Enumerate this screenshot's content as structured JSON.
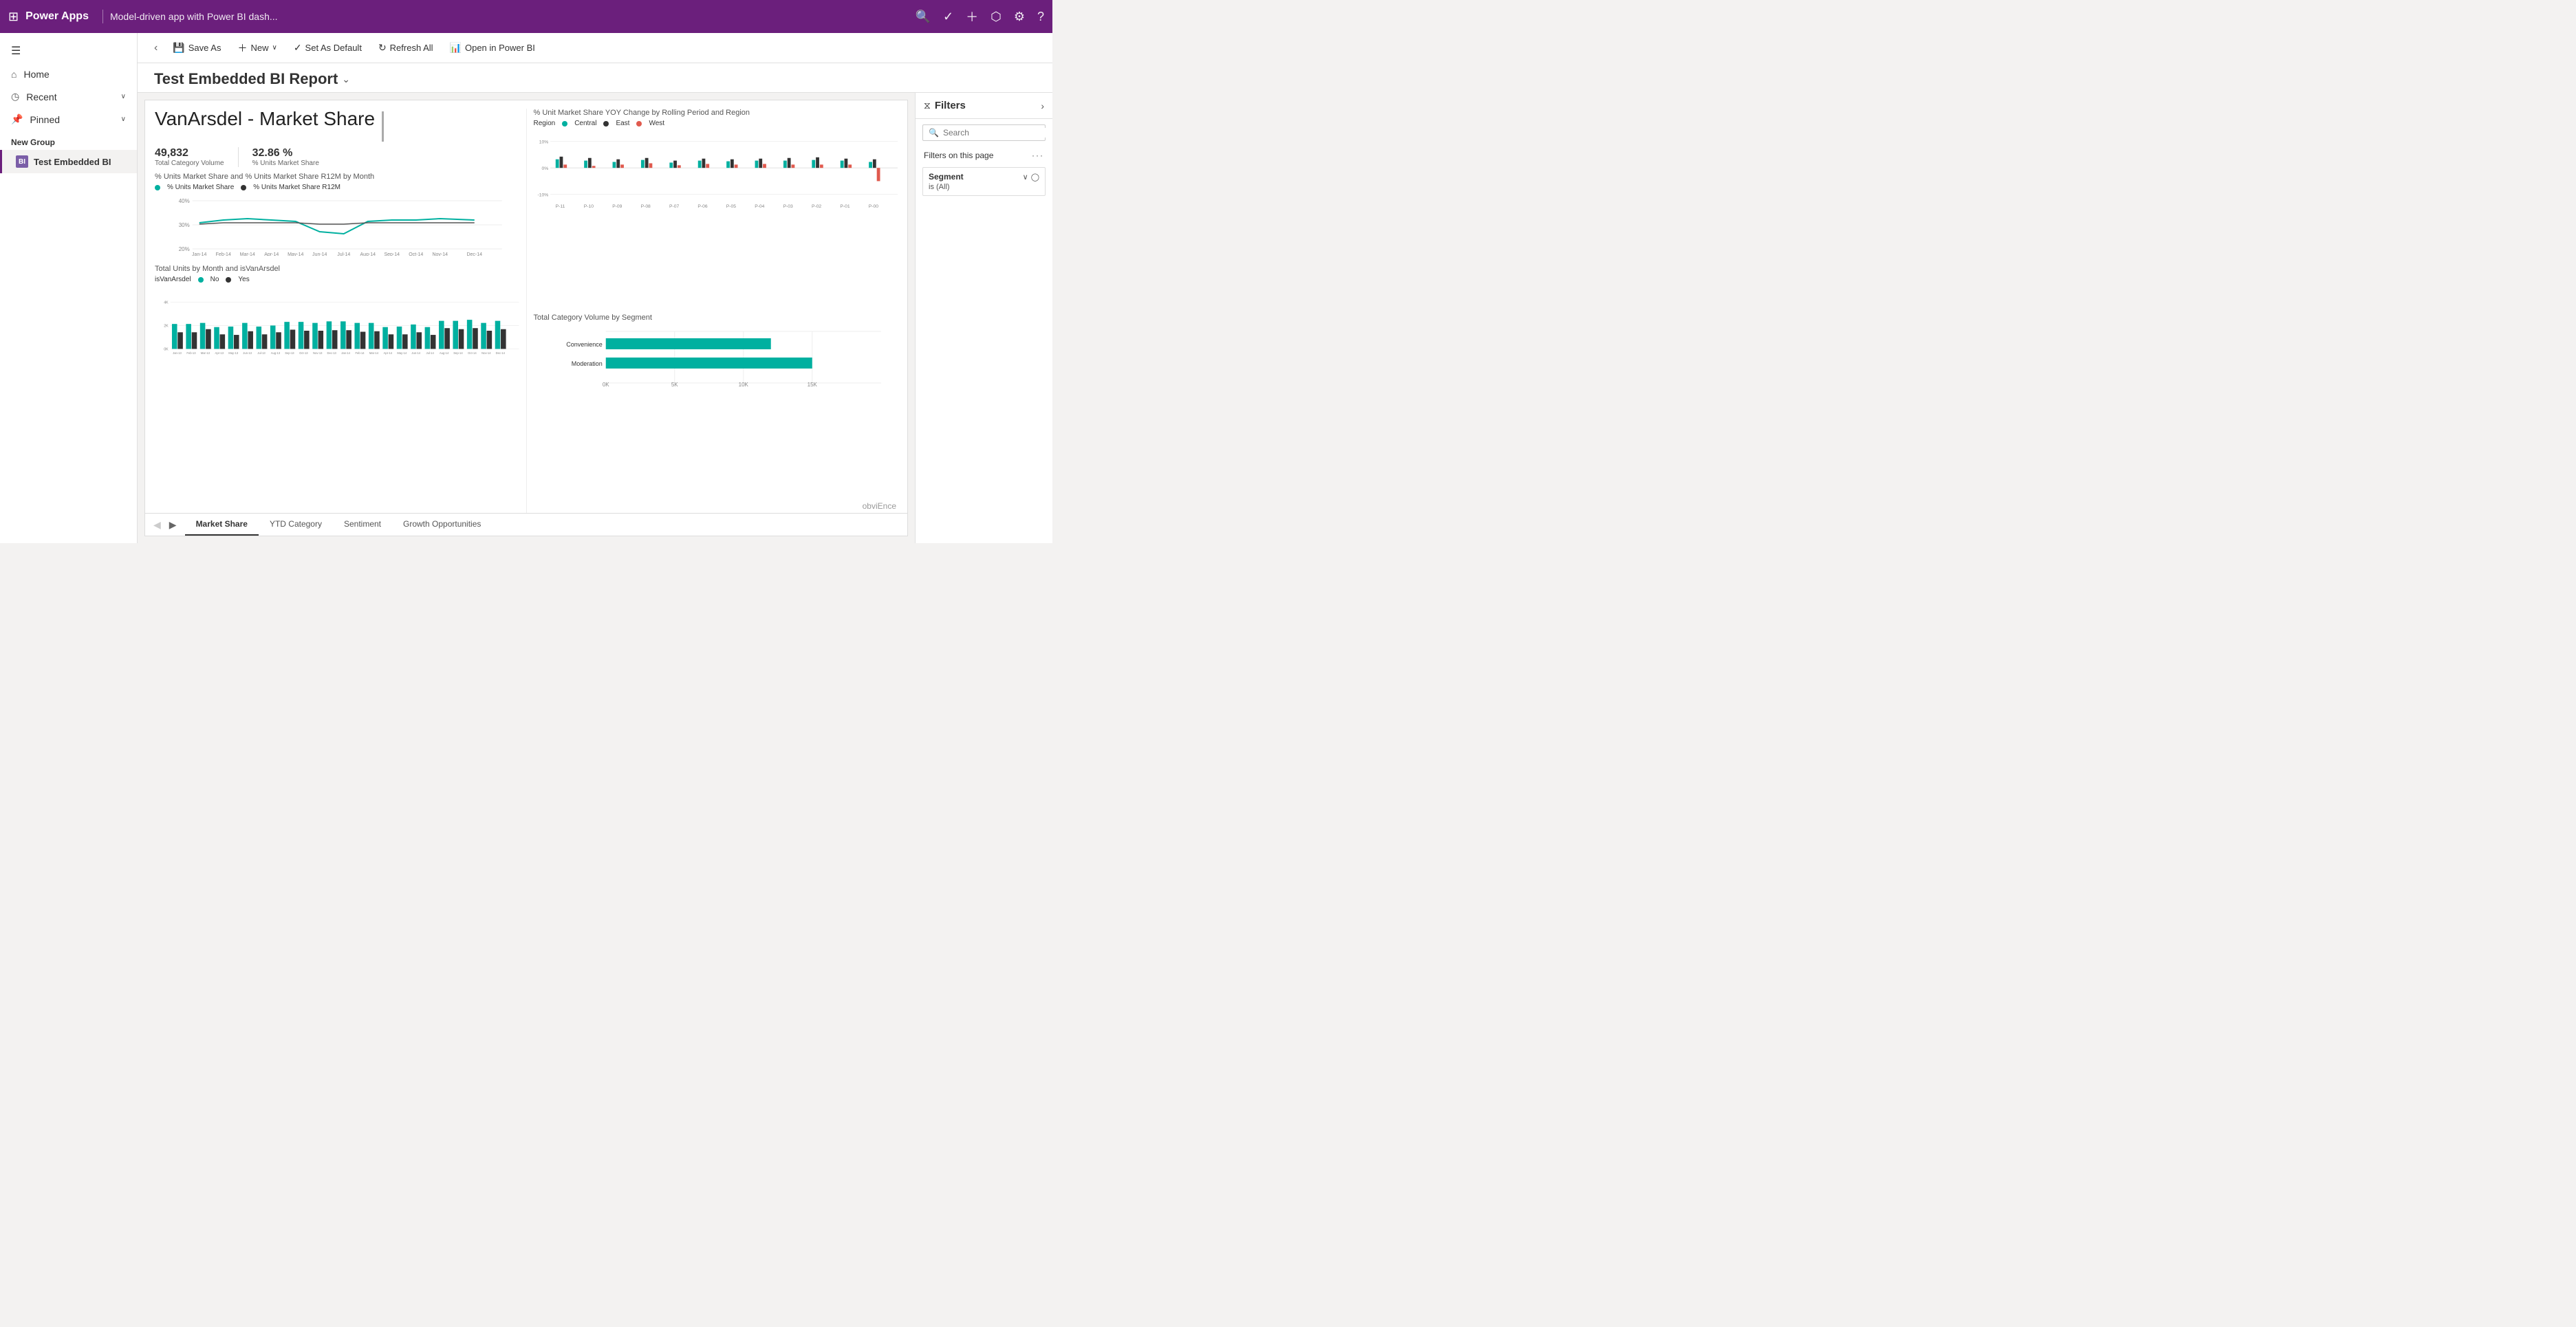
{
  "topNav": {
    "logo": "Power Apps",
    "appTitle": "Model-driven app with Power BI dash...",
    "icons": [
      "search",
      "circle-check",
      "plus",
      "filter",
      "gear",
      "question"
    ]
  },
  "sidebar": {
    "hamburgerLabel": "☰",
    "items": [
      {
        "label": "Home",
        "icon": "⌂"
      },
      {
        "label": "Recent",
        "icon": "◷",
        "hasChevron": true
      },
      {
        "label": "Pinned",
        "icon": "📌",
        "hasChevron": true
      }
    ],
    "groupLabel": "New Group",
    "navItems": [
      {
        "label": "Test Embedded BI",
        "icon": "BI",
        "active": true
      }
    ]
  },
  "toolbar": {
    "backLabel": "‹",
    "saveAsLabel": "Save As",
    "newLabel": "New",
    "setAsDefaultLabel": "Set As Default",
    "refreshAllLabel": "Refresh All",
    "openInPowerBILabel": "Open in Power BI"
  },
  "pageHeader": {
    "title": "Test Embedded BI Report",
    "chevron": "⌄"
  },
  "report": {
    "mainTitle": "VanArsdel - Market Share",
    "kpis": [
      {
        "value": "49,832",
        "label": "Total Category Volume"
      },
      {
        "value": "32.86 %",
        "label": "% Units Market Share"
      }
    ],
    "yoyChart": {
      "title": "% Unit Market Share YOY Change by Rolling Period and Region",
      "legend": [
        {
          "color": "#00b0a0",
          "label": "Central"
        },
        {
          "color": "#333",
          "label": "East"
        },
        {
          "color": "#e05a4e",
          "label": "West"
        }
      ],
      "yLabels": [
        "10%",
        "0%",
        "-10%"
      ],
      "xLabels": [
        "P-11",
        "P-10",
        "P-09",
        "P-08",
        "P-07",
        "P-06",
        "P-05",
        "P-04",
        "P-03",
        "P-02",
        "P-01",
        "P-00"
      ]
    },
    "lineChart": {
      "title": "% Units Market Share and % Units Market Share R12M by Month",
      "legend": [
        {
          "color": "#00b0a0",
          "label": "% Units Market Share"
        },
        {
          "color": "#333",
          "label": "% Units Market Share R12M"
        }
      ],
      "yLabels": [
        "40%",
        "30%",
        "20%"
      ],
      "xLabels": [
        "Jan-14",
        "Feb-14",
        "Mar-14",
        "Apr-14",
        "May-14",
        "Jun-14",
        "Jul-14",
        "Aug-14",
        "Sep-14",
        "Oct-14",
        "Nov-14",
        "Dec-14"
      ]
    },
    "hbarChart": {
      "title": "Total Category Volume by Segment",
      "bars": [
        {
          "label": "Convenience",
          "value": 70,
          "color": "#00b0a0"
        },
        {
          "label": "Moderation",
          "value": 85,
          "color": "#00b0a0"
        }
      ],
      "xLabels": [
        "0K",
        "5K",
        "10K",
        "15K"
      ]
    },
    "bottomChart": {
      "title": "Total Units by Month and isVanArsdel",
      "legendLabel": "isVanArsdel",
      "legend": [
        {
          "color": "#00b0a0",
          "label": "No"
        },
        {
          "color": "#333",
          "label": "Yes"
        }
      ],
      "yLabels": [
        "4K",
        "2K",
        "0K"
      ],
      "xLabels": [
        "Jan-13",
        "Feb-13",
        "Mar-13",
        "Apr-13",
        "May-13",
        "Jun-13",
        "Jul-13",
        "Aug-13",
        "Sep-13",
        "Oct-13",
        "Nov-13",
        "Dec-13",
        "Jan-14",
        "Feb-14",
        "Mar-14",
        "Apr-14",
        "May-14",
        "Jun-14",
        "Jul-14",
        "Aug-14",
        "Sep-14",
        "Oct-14",
        "Nov-14",
        "Dec-14"
      ]
    },
    "branding": "obviEnce",
    "tabs": [
      {
        "label": "Market Share",
        "active": true
      },
      {
        "label": "YTD Category",
        "active": false
      },
      {
        "label": "Sentiment",
        "active": false
      },
      {
        "label": "Growth Opportunities",
        "active": false
      }
    ]
  },
  "filters": {
    "title": "Filters",
    "searchPlaceholder": "Search",
    "sectionTitle": "Filters on this page",
    "cards": [
      {
        "label": "Segment",
        "value": "is (All)"
      }
    ]
  }
}
